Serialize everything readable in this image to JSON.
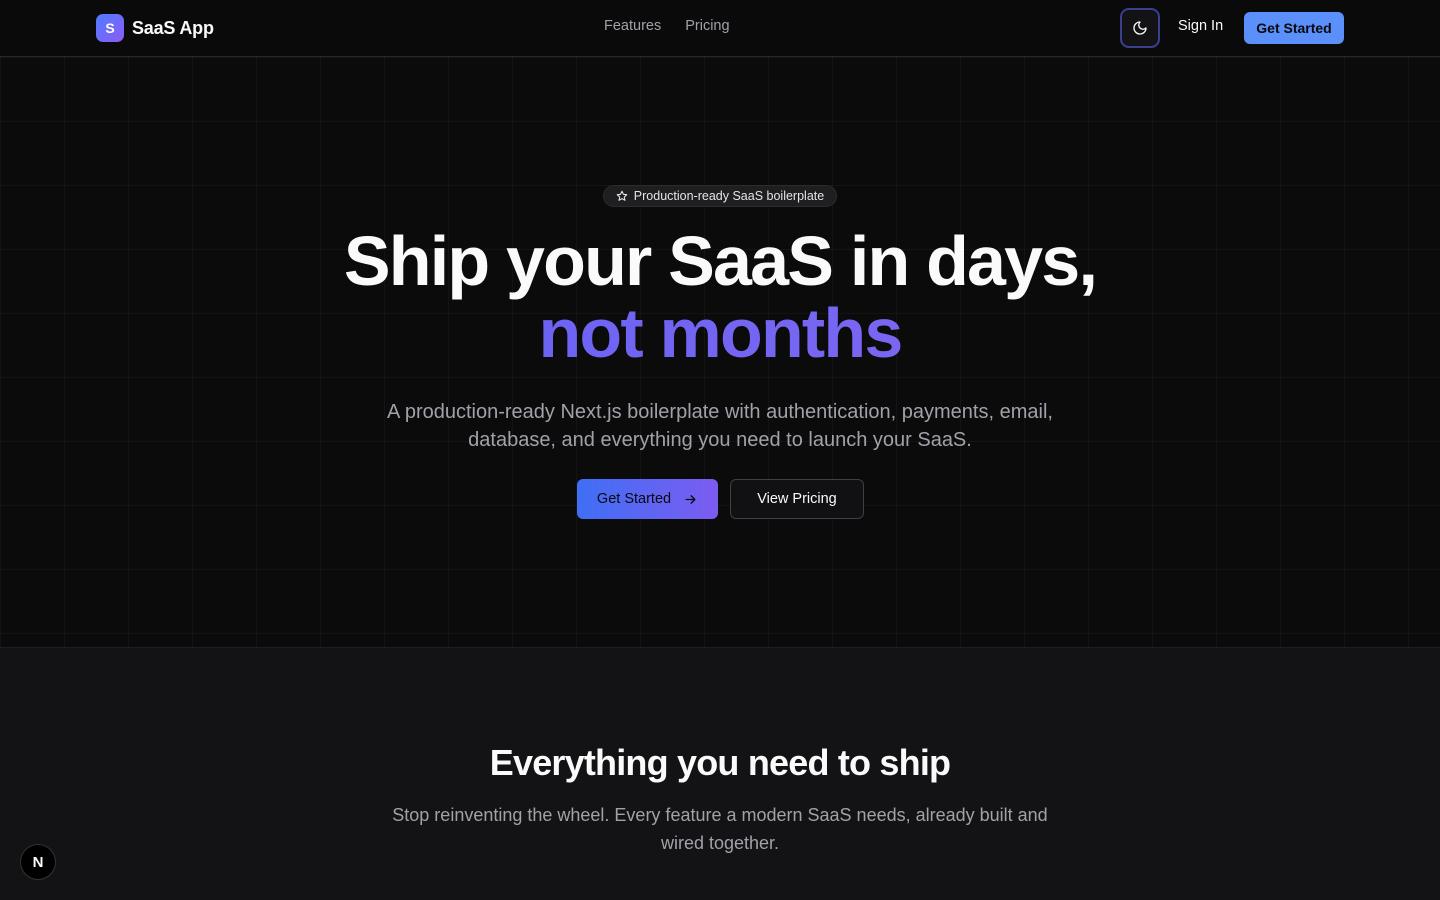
{
  "navbar": {
    "brand_initial": "S",
    "brand_name": "SaaS App",
    "links": [
      {
        "label": "Features"
      },
      {
        "label": "Pricing"
      }
    ],
    "theme_icon": "moon-icon",
    "signin_label": "Sign In",
    "cta_label": "Get Started"
  },
  "hero": {
    "badge_icon": "star-icon",
    "badge_text": "Production-ready SaaS boilerplate",
    "title_line1": "Ship your SaaS in days,",
    "title_line2": "not months",
    "subtitle": "A production-ready Next.js boilerplate with authentication, payments, email, database, and everything you need to launch your SaaS.",
    "primary_cta": "Get Started",
    "primary_cta_icon": "arrow-right-icon",
    "secondary_cta": "View Pricing"
  },
  "features": {
    "title": "Everything you need to ship",
    "subtitle": "Stop reinventing the wheel. Every feature a modern SaaS needs, already built and wired together."
  },
  "dev_badge": {
    "label": "N",
    "icon": "nextjs-icon"
  },
  "colors": {
    "background": "#0b0b0c",
    "accent_blue": "#5b8ff9",
    "gradient_start": "#3f6ff5",
    "gradient_end": "#7c5cf0",
    "muted_text": "#a1a1aa"
  }
}
